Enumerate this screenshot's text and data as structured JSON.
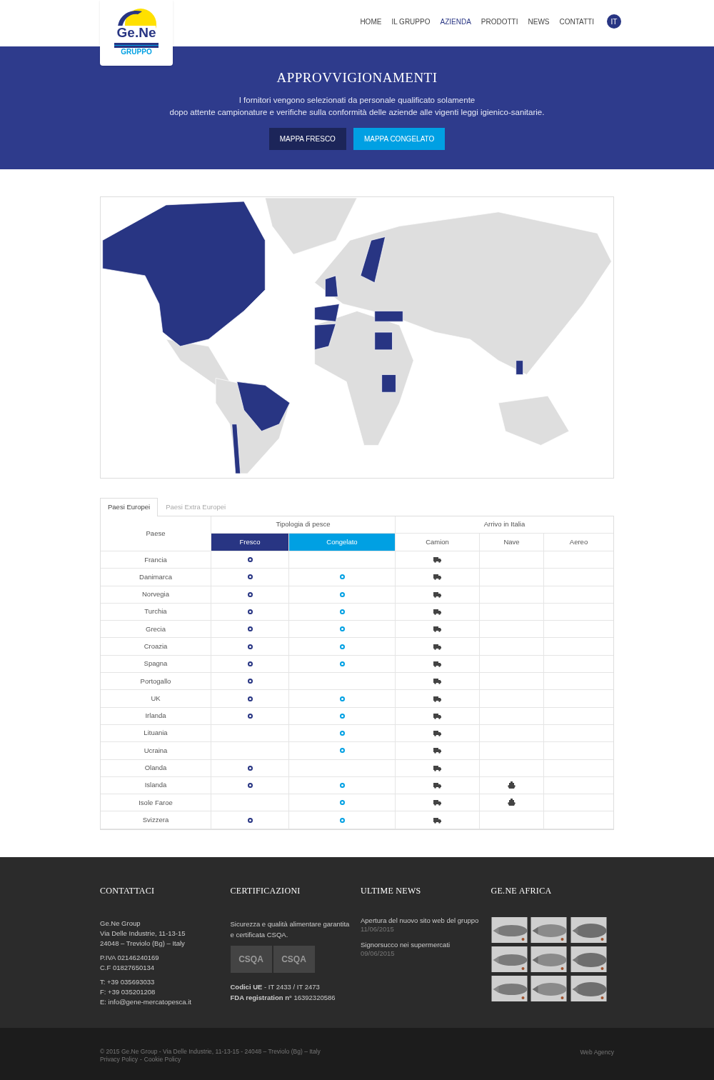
{
  "logo": {
    "name": "Ge.Ne",
    "subtitle": "GRUPPO"
  },
  "nav": [
    {
      "label": "HOME",
      "selected": false
    },
    {
      "label": "IL GRUPPO",
      "selected": false
    },
    {
      "label": "AZIENDA",
      "selected": true
    },
    {
      "label": "PRODOTTI",
      "selected": false
    },
    {
      "label": "NEWS",
      "selected": false
    },
    {
      "label": "CONTATTI",
      "selected": false
    }
  ],
  "language": "IT",
  "hero": {
    "title": "APPROVVIGIONAMENTI",
    "lines": [
      "I fornitori vengono selezionati da personale qualificato solamente",
      "dopo attente campionature e verifiche sulla conformità delle aziende alle vigenti leggi igienico-sanitarie."
    ],
    "buttons": [
      {
        "label": "MAPPA FRESCO",
        "kind": "dark"
      },
      {
        "label": "MAPPA CONGELATO",
        "kind": "light"
      }
    ]
  },
  "tabs": [
    {
      "label": "Paesi Europei",
      "selected": true
    },
    {
      "label": "Paesi Extra Europei",
      "selected": false
    }
  ],
  "table": {
    "country_header": "Paese",
    "group_headers": [
      "Tipologia di pesce",
      "Arrivo in Italia"
    ],
    "columns": [
      "Fresco",
      "Congelato",
      "Camion",
      "Nave",
      "Aereo"
    ],
    "rows": [
      {
        "country": "Francia",
        "fresco": true,
        "congelato": false,
        "camion": true,
        "nave": false
      },
      {
        "country": "Danimarca",
        "fresco": true,
        "congelato": true,
        "camion": true,
        "nave": false
      },
      {
        "country": "Norvegia",
        "fresco": true,
        "congelato": true,
        "camion": true,
        "nave": false
      },
      {
        "country": "Turchia",
        "fresco": true,
        "congelato": true,
        "camion": true,
        "nave": false
      },
      {
        "country": "Grecia",
        "fresco": true,
        "congelato": true,
        "camion": true,
        "nave": false
      },
      {
        "country": "Croazia",
        "fresco": true,
        "congelato": true,
        "camion": true,
        "nave": false
      },
      {
        "country": "Spagna",
        "fresco": true,
        "congelato": true,
        "camion": true,
        "nave": false
      },
      {
        "country": "Portogallo",
        "fresco": true,
        "congelato": false,
        "camion": true,
        "nave": false
      },
      {
        "country": "UK",
        "fresco": true,
        "congelato": true,
        "camion": true,
        "nave": false
      },
      {
        "country": "Irlanda",
        "fresco": true,
        "congelato": true,
        "camion": true,
        "nave": false
      },
      {
        "country": "Lituania",
        "fresco": false,
        "congelato": true,
        "camion": true,
        "nave": false
      },
      {
        "country": "Ucraina",
        "fresco": false,
        "congelato": true,
        "camion": true,
        "nave": false
      },
      {
        "country": "Olanda",
        "fresco": true,
        "congelato": false,
        "camion": true,
        "nave": false
      },
      {
        "country": "Islanda",
        "fresco": true,
        "congelato": true,
        "camion": true,
        "nave": true
      },
      {
        "country": "Isole Faroe",
        "fresco": false,
        "congelato": true,
        "camion": true,
        "nave": true
      },
      {
        "country": "Svizzera",
        "fresco": true,
        "congelato": true,
        "camion": true,
        "nave": false
      }
    ]
  },
  "footer": {
    "contact": {
      "title": "CONTATTACI",
      "blocks": [
        [
          "Ge.Ne Group",
          "Via Delle Industrie, 11-13-15",
          "24048 – Treviolo (Bg) – Italy"
        ],
        [
          "P.IVA 02146240169",
          "C.F 01827650134"
        ],
        [
          "T: +39 035693033",
          "F: +39 035201208",
          "E: info@gene-mercatopesca.it"
        ]
      ]
    },
    "certifications": {
      "title": "CERTIFICAZIONI",
      "text": "Sicurezza e qualità alimentare garantita e certificata CSQA.",
      "logos": [
        "CSQA",
        "CSQA"
      ],
      "codes": [
        "**Codici UE** - IT 2433 / IT 2473",
        "**FDA registration n°** 16392320586"
      ]
    },
    "news": {
      "title": "ULTIME NEWS",
      "items": [
        {
          "title": "Apertura del nuovo sito web del gruppo",
          "date": "11/06/2015"
        },
        {
          "title": "Signorsucco nei supermercati",
          "date": "09/06/2015"
        }
      ]
    },
    "africa": {
      "title": "GE.NE AFRICA"
    }
  },
  "bottom": {
    "copyright": "© 2015 Ge.Ne Group - Via Delle Industrie, 11-13-15 - 24048 – Treviolo (Bg) – Italy",
    "links": [
      "Privacy Policy",
      "Cookie Policy"
    ],
    "separator": "-",
    "agency": "Web Agency"
  }
}
